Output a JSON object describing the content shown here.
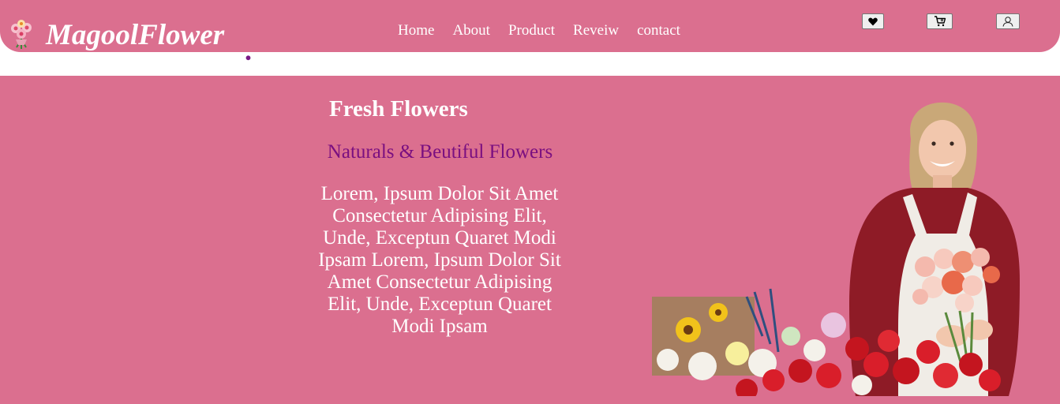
{
  "header": {
    "logo_text": "MagoolFlower",
    "logo_dot": ".",
    "nav": [
      {
        "label": "Home"
      },
      {
        "label": "About"
      },
      {
        "label": "Product"
      },
      {
        "label": "Reveiw"
      },
      {
        "label": "contact"
      }
    ],
    "icons": [
      "heart-icon",
      "cart-icon",
      "user-icon"
    ]
  },
  "hero": {
    "title": "Fresh Flowers",
    "subtitle": "Naturals & Beutiful Flowers",
    "body": "Lorem, Ipsum Dolor Sit Amet Consectetur Adipising Elit, Unde, Exceptun Quaret Modi Ipsam Lorem, Ipsum Dolor Sit Amet Consectetur Adipising Elit, Unde, Exceptun Quaret Modi Ipsam"
  },
  "colors": {
    "brand_pink": "#db6f8f",
    "subtitle_purple": "#7a0f80",
    "logo_dot": "#7a1a86",
    "text": "#ffffff"
  }
}
